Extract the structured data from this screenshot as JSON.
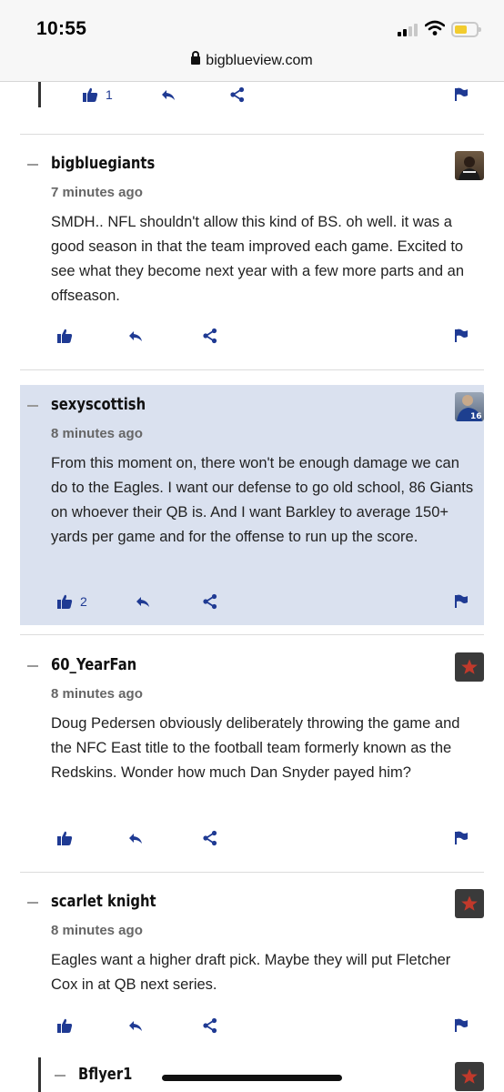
{
  "status_bar": {
    "time": "10:55"
  },
  "browser": {
    "domain": "bigblueview.com"
  },
  "top_partial": {
    "likes": "1"
  },
  "comments": [
    {
      "author": "bigbluegiants",
      "time": "7 minutes ago",
      "body": "SMDH.. NFL shouldn't allow this kind of BS.  oh well.  it was a good season in that the team improved each game.  Excited to see what they become next year with a few more parts and an offseason.",
      "likes": "",
      "avatar": "person-photo"
    },
    {
      "author": "sexyscottish",
      "time": "8 minutes ago",
      "body": "From this moment on, there won't be enough damage we can do to the Eagles.  I want our defense to go old school, 86 Giants on whoever their QB is.  And I want Barkley to average 150+ yards per game and for the offense to run up the score.",
      "likes": "2",
      "avatar": "player-16-photo"
    },
    {
      "author": "60_YearFan",
      "time": "8 minutes ago",
      "body": "Doug Pedersen obviously deliberately throwing the game and the NFC East title to the football team formerly known as the Redskins.  Wonder how much Dan Snyder payed him?",
      "likes": "",
      "avatar": "star-icon"
    },
    {
      "author": "scarlet knight",
      "time": "8 minutes ago",
      "body": "Eagles want a higher draft pick. Maybe they will put Fletcher Cox in at QB next series.",
      "likes": "",
      "avatar": "star-icon"
    },
    {
      "author": "Bflyer1",
      "avatar": "star-icon"
    }
  ],
  "colors": {
    "accent": "#1f3a93",
    "highlight": "#dae1ef",
    "star": "#c0392b"
  }
}
